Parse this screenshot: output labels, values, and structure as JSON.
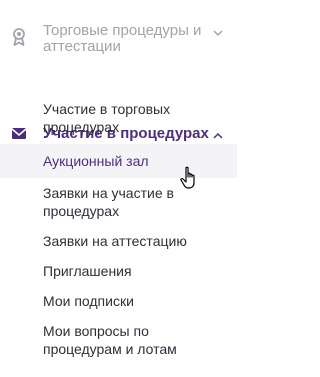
{
  "sidebar": {
    "sections": [
      {
        "label": "Торговые процедуры и аттестации",
        "icon": "award-ribbon-icon",
        "state": "collapsed",
        "chevron": "chevron-down-icon"
      },
      {
        "label": "Участие в процедурах",
        "icon": "envelope-icon",
        "state": "expanded",
        "chevron": "chevron-up-icon"
      }
    ],
    "items": [
      {
        "label": "Участие в торговых процедурах",
        "active": false
      },
      {
        "label": "Аукционный зал",
        "active": true
      },
      {
        "label": "Заявки на участие в процедурах",
        "active": false
      },
      {
        "label": "Заявки на аттестацию",
        "active": false
      },
      {
        "label": "Приглашения",
        "active": false
      },
      {
        "label": "Мои подписки",
        "active": false
      },
      {
        "label": "Мои вопросы по процедурам и лотам",
        "active": false
      }
    ]
  },
  "colors": {
    "muted": "#a4a2ad",
    "accent": "#4b2f7d",
    "text": "#2e2f3a",
    "active_bg": "#f4f4f7"
  }
}
